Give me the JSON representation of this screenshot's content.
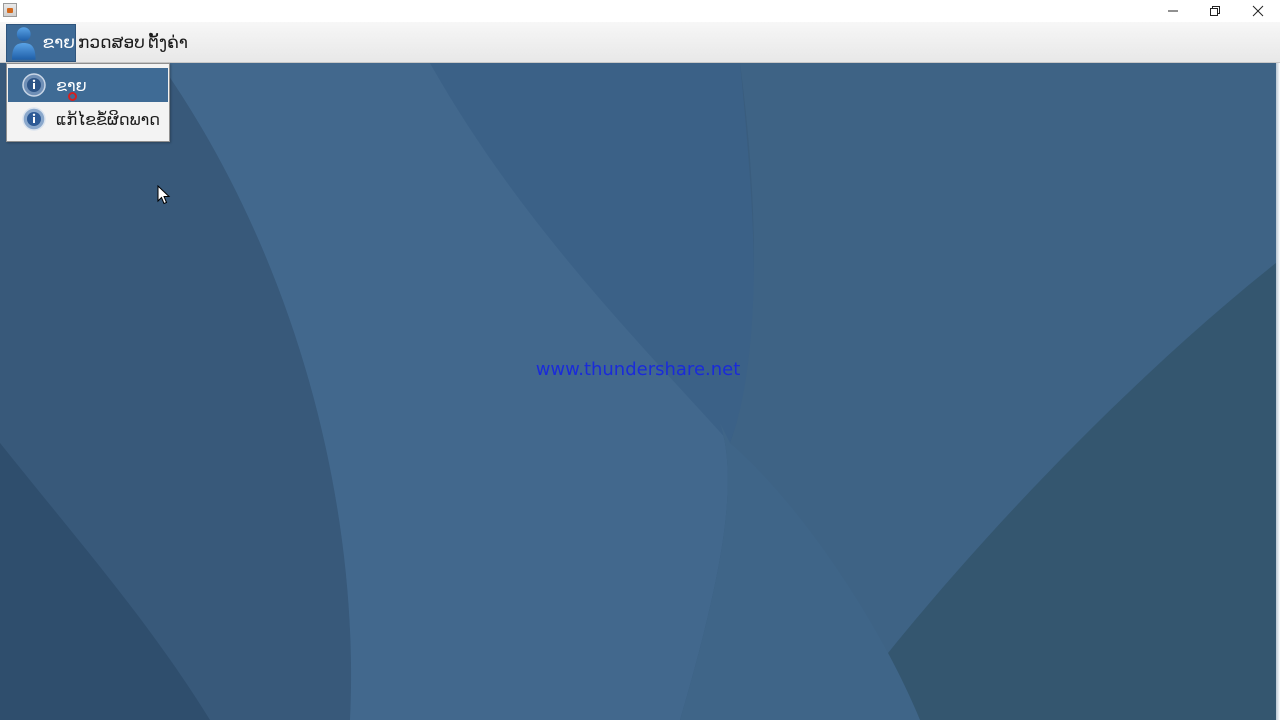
{
  "menubar": {
    "user_menu": "ຂາຍ",
    "exam_menu": "ກວດສອບ",
    "settings_menu": "ຕັ້ງຄ່າ"
  },
  "dropdown": {
    "items": [
      {
        "label": "ຂາຍ",
        "icon": "info-icon",
        "selected": true
      },
      {
        "label": "ແກ້ໄຂຂໍ້ຜິດພາດ",
        "icon": "info-icon",
        "selected": false
      }
    ]
  },
  "watermark": "www.thundershare.net",
  "colors": {
    "desktop": "#3a5d7e",
    "menu_highlight": "#3e6a96",
    "watermark_text": "#1a2bd9",
    "click_marker": "#d32020"
  }
}
